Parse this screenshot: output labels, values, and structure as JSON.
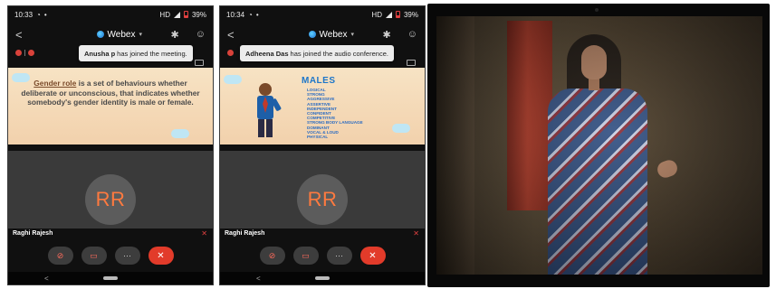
{
  "phone1": {
    "status": {
      "time": "10:33",
      "network": "HD",
      "battery": "39%"
    },
    "header": {
      "brand": "Webex"
    },
    "toast": {
      "name": "Anusha p",
      "message": "has joined the meeting."
    },
    "slide": {
      "term": "Gender role",
      "definition": "is a set of behaviours whether deliberate or unconscious, that indicates whether somebody's gender identity is male or female."
    },
    "participant": {
      "initials": "RR",
      "name": "Raghi Rajesh"
    }
  },
  "phone2": {
    "status": {
      "time": "10:34",
      "network": "HD",
      "battery": "39%"
    },
    "header": {
      "brand": "Webex"
    },
    "toast": {
      "name": "Adheena Das",
      "message": "has joined the audio conference."
    },
    "slide": {
      "title": "MALES",
      "traits": [
        "LOGICAL",
        "STRONG",
        "AGGRESSIVE",
        "ASSERTIVE",
        "INDEPENDENT",
        "CONFIDENT",
        "COMPETITIVE",
        "STRONG BODY LANGUAGE",
        "DOMINANT",
        "VOCAL & LOUD",
        "PHYSICAL"
      ]
    },
    "participant": {
      "initials": "RR",
      "name": "Raghi Rajesh"
    }
  },
  "colors": {
    "accent": "#ff7a3f",
    "end_call": "#e23b2a",
    "slide_title": "#1d76c9"
  }
}
